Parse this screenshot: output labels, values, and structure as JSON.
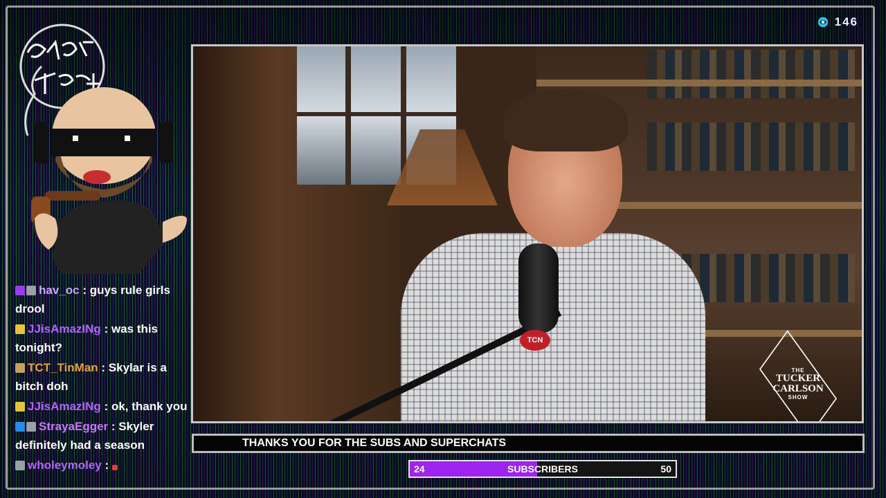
{
  "viewer_count": "146",
  "ticker_text": "THANKS YOU FOR THE SUBS AND SUPERCHATS",
  "sub_goal": {
    "current": "24",
    "label": "SUBSCRIBERS",
    "goal": "50",
    "progress_fraction": 0.48
  },
  "show_logo": {
    "line1": "THE",
    "line2": "TUCKER",
    "line3": "CARLSON",
    "line4": "SHOW"
  },
  "mic_badge": "TCN",
  "chat": [
    {
      "user": "hav_oc",
      "color": "#c8a8ff",
      "message": "guys rule girls drool",
      "badges": [
        "purple-cube-icon",
        "mod-icon"
      ]
    },
    {
      "user": "JJisAmazINg",
      "color": "#b266ff",
      "message": "was this tonight?",
      "badges": [
        "gold-icon"
      ]
    },
    {
      "user": "TCT_TinMan",
      "color": "#e8a23a",
      "message": "Skylar is a bitch doh",
      "badges": [
        "pirate-icon"
      ]
    },
    {
      "user": "JJisAmazINg",
      "color": "#b266ff",
      "message": "ok, thank you",
      "badges": [
        "gold-icon"
      ]
    },
    {
      "user": "StrayaEgger",
      "color": "#c47aff",
      "message": "Skyler definitely had a season",
      "badges": [
        "blue-arrow-icon",
        "mod-icon"
      ]
    },
    {
      "user": "wholeymoley",
      "color": "#b266ff",
      "message": "",
      "badges": [
        "mod-icon"
      ],
      "emote": "red-heart-icon"
    }
  ]
}
